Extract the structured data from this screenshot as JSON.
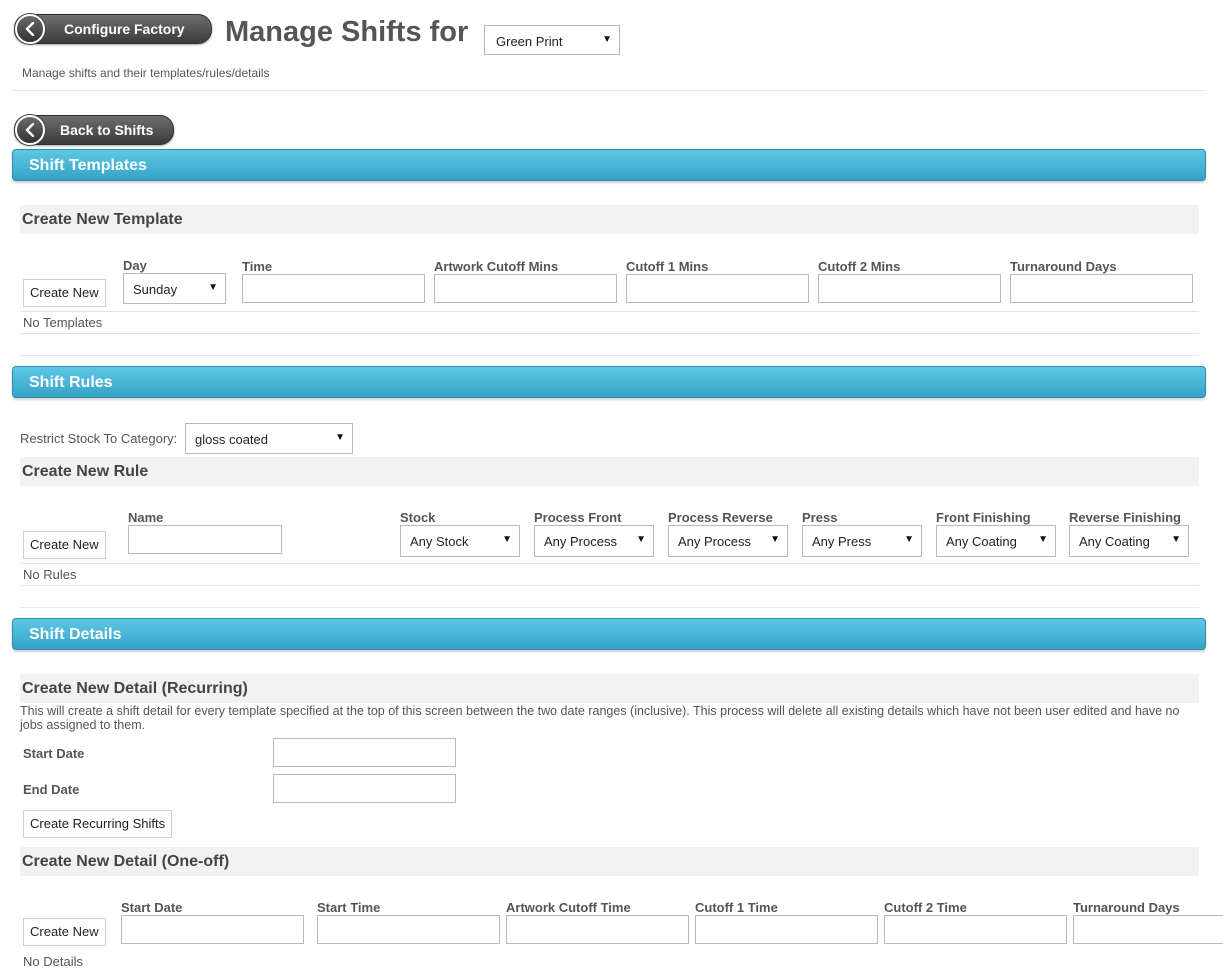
{
  "header": {
    "configure_button": "Configure Factory",
    "title": "Manage Shifts for",
    "factory_select": "Green Print",
    "subtitle": "Manage shifts and their templates/rules/details",
    "back_button": "Back to Shifts"
  },
  "templates": {
    "section_title": "Shift Templates",
    "create_heading": "Create New Template",
    "create_button": "Create New",
    "fields": {
      "day_label": "Day",
      "day_value": "Sunday",
      "time_label": "Time",
      "artwork_label": "Artwork Cutoff Mins",
      "cutoff1_label": "Cutoff 1 Mins",
      "cutoff2_label": "Cutoff 2 Mins",
      "turnaround_label": "Turnaround Days"
    },
    "empty_text": "No Templates"
  },
  "rules": {
    "section_title": "Shift Rules",
    "restrict_label": "Restrict Stock To Category:",
    "restrict_value": "gloss coated",
    "create_heading": "Create New Rule",
    "create_button": "Create New",
    "fields": {
      "name_label": "Name",
      "stock_label": "Stock",
      "stock_value": "Any Stock",
      "process_front_label": "Process Front",
      "process_front_value": "Any Process",
      "process_reverse_label": "Process Reverse",
      "process_reverse_value": "Any Process",
      "press_label": "Press",
      "press_value": "Any Press",
      "front_finishing_label": "Front Finishing",
      "front_finishing_value": "Any Coating",
      "reverse_finishing_label": "Reverse Finishing",
      "reverse_finishing_value": "Any Coating"
    },
    "empty_text": "No Rules"
  },
  "details": {
    "section_title": "Shift Details",
    "recurring_heading": "Create New Detail (Recurring)",
    "recurring_description": "This will create a shift detail for every template specified at the top of this screen between the two date ranges (inclusive). This process will delete all existing details which have not been user edited and have no jobs assigned to them.",
    "start_date_label": "Start Date",
    "end_date_label": "End Date",
    "recurring_button": "Create Recurring Shifts",
    "oneoff_heading": "Create New Detail (One-off)",
    "oneoff_button": "Create New",
    "oneoff_fields": {
      "start_date_label": "Start Date",
      "start_time_label": "Start Time",
      "artwork_label": "Artwork Cutoff Time",
      "cutoff1_label": "Cutoff 1 Time",
      "cutoff2_label": "Cutoff 2 Time",
      "turnaround_label": "Turnaround Days"
    },
    "empty_text": "No Details"
  },
  "icons": {
    "back": "chevron-left-icon",
    "dropdown": "caret-down-icon"
  }
}
